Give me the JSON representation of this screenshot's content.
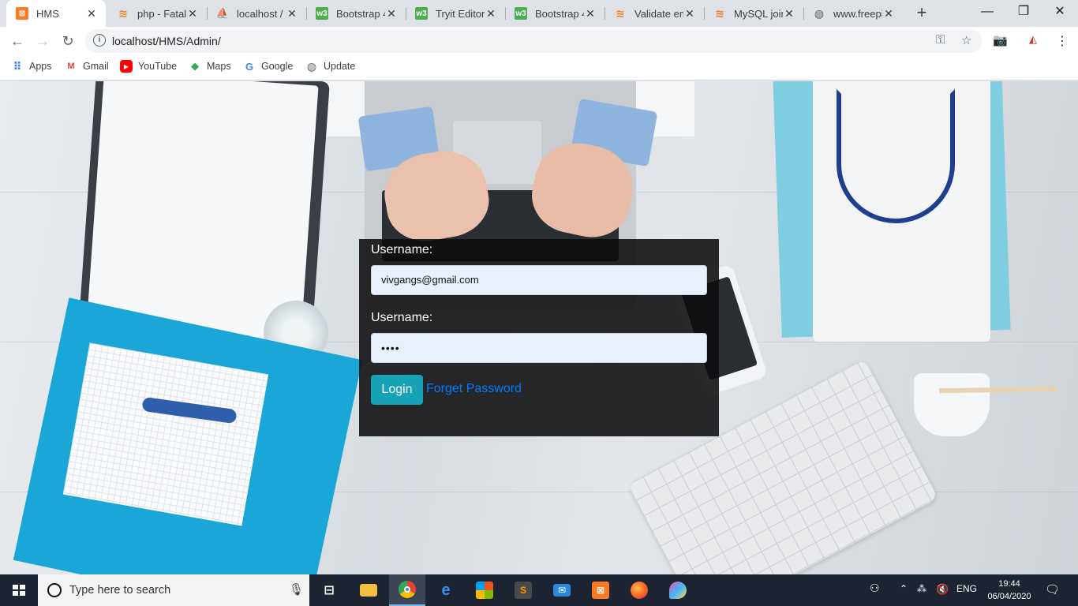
{
  "tabs": [
    {
      "title": "HMS",
      "icon": "xampp-icon"
    },
    {
      "title": "php - Fatal",
      "icon": "stackoverflow-icon"
    },
    {
      "title": "localhost /",
      "icon": "phpmyadmin-icon"
    },
    {
      "title": "Bootstrap 4",
      "icon": "w3schools-icon"
    },
    {
      "title": "Tryit Editor",
      "icon": "w3schools-icon"
    },
    {
      "title": "Bootstrap 4",
      "icon": "w3schools-icon"
    },
    {
      "title": "Validate em",
      "icon": "stackoverflow-icon"
    },
    {
      "title": "MySQL join",
      "icon": "stackoverflow-icon"
    },
    {
      "title": "www.freepil",
      "icon": "globe-icon"
    }
  ],
  "address": {
    "url": "localhost/HMS/Admin/"
  },
  "bookmarks": [
    {
      "label": "Apps",
      "icon": "apps-grid-icon"
    },
    {
      "label": "Gmail",
      "icon": "gmail-icon"
    },
    {
      "label": "YouTube",
      "icon": "youtube-icon"
    },
    {
      "label": "Maps",
      "icon": "maps-icon"
    },
    {
      "label": "Google",
      "icon": "google-icon"
    },
    {
      "label": "Update",
      "icon": "globe-icon"
    }
  ],
  "login": {
    "username_label": "Username:",
    "username_value": "vivgangs@gmail.com",
    "password_label": "Username:",
    "password_value": "••••",
    "login_button": "Login",
    "forget_link": "Forget Password"
  },
  "taskbar": {
    "search_placeholder": "Type here to search",
    "language": "ENG",
    "time": "19:44",
    "date": "06/04/2020"
  },
  "colors": {
    "login_button": "#17a2b8",
    "link": "#007bff",
    "panel": "#0c0c0e",
    "taskbar": "#1b2430"
  }
}
